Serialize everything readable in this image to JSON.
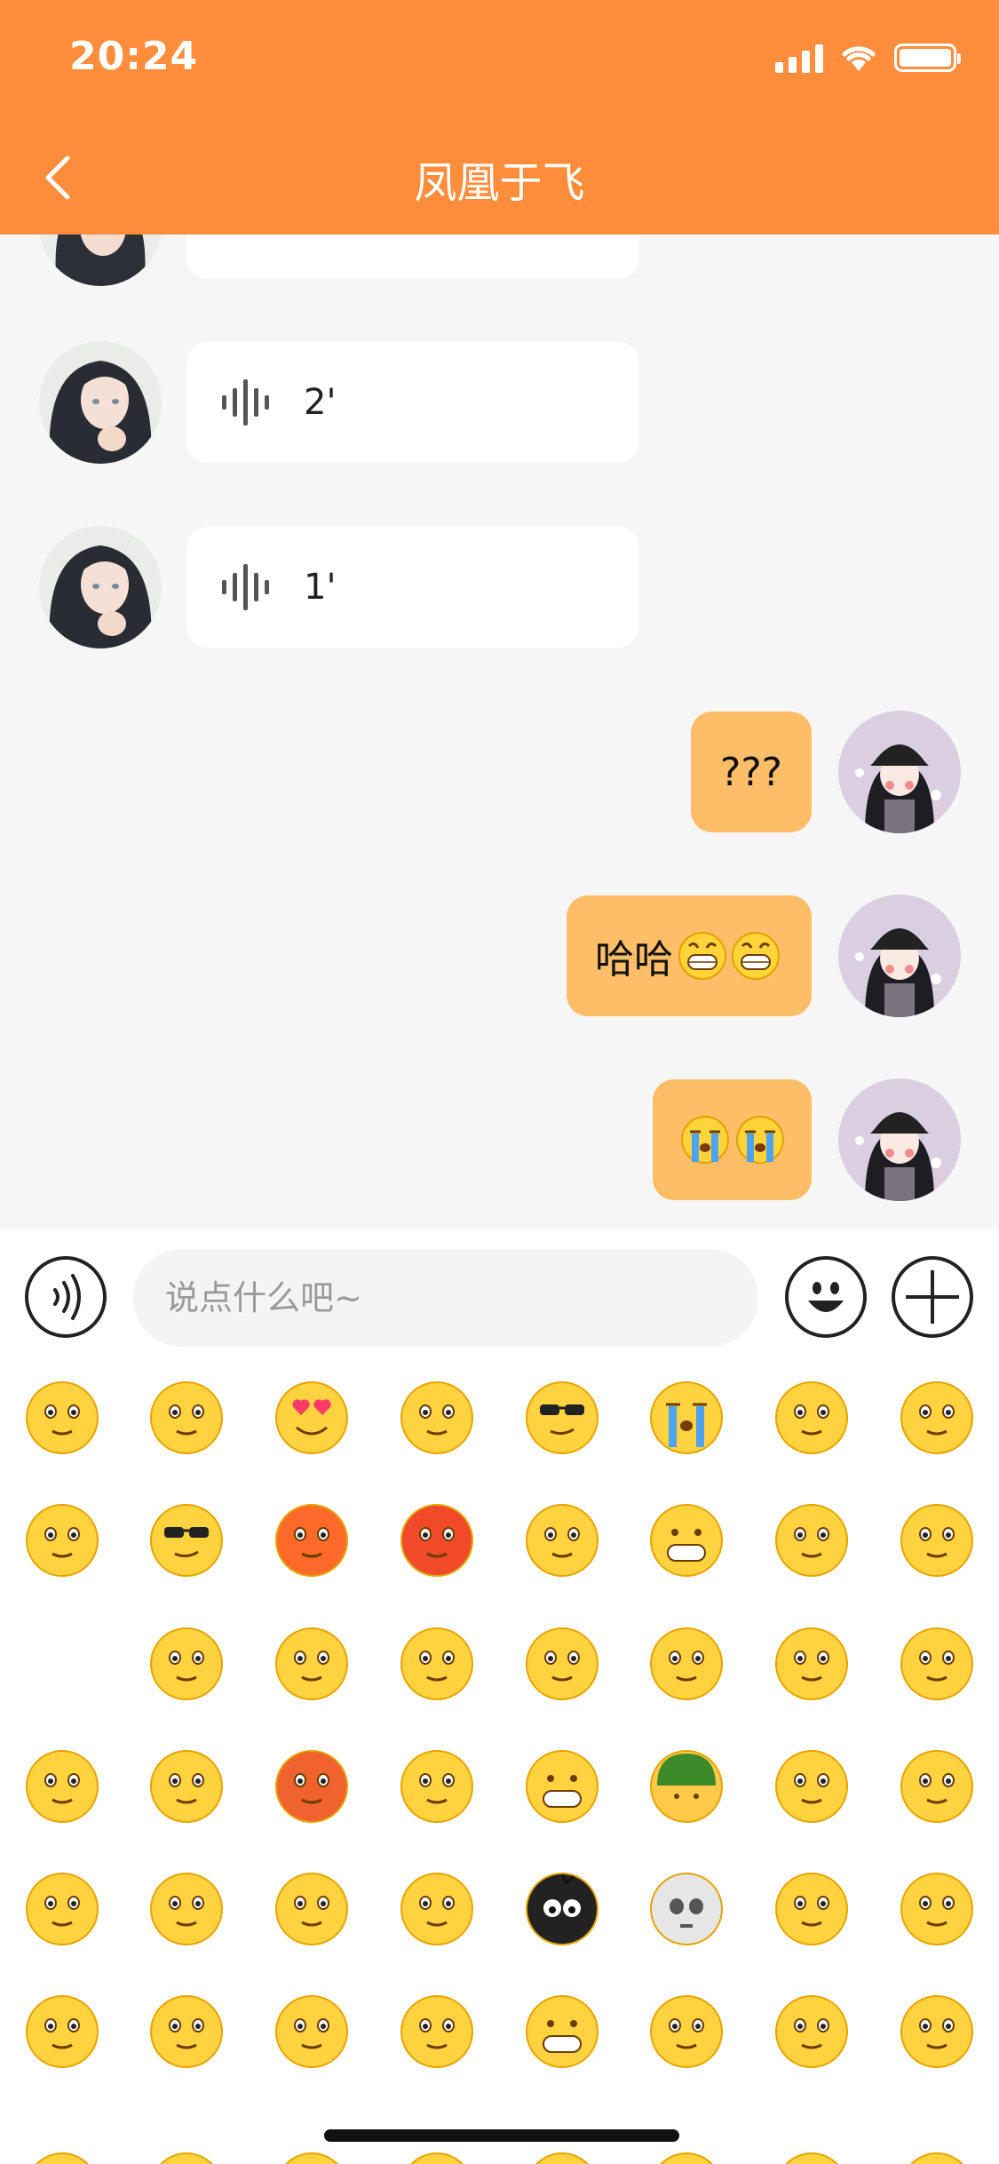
{
  "status_bar": {
    "time": "20:24"
  },
  "header": {
    "title": "凤凰于飞"
  },
  "messages": [
    {
      "side": "in",
      "type": "voice",
      "duration": "2'"
    },
    {
      "side": "in",
      "type": "voice",
      "duration": "1'"
    },
    {
      "side": "out",
      "type": "text",
      "text": "???"
    },
    {
      "side": "out",
      "type": "text",
      "text": "哈哈"
    },
    {
      "side": "out",
      "type": "emoji-only",
      "text": ""
    }
  ],
  "input_bar": {
    "placeholder": "说点什么吧~"
  },
  "colors": {
    "header": "#FF8D3C",
    "outgoing_bubble": "#FDBE67",
    "incoming_bubble": "#FFFFFF"
  },
  "emoji_panel": {
    "icons": [
      "smile-icon",
      "worried-icon",
      "heart-eyes-icon",
      "glare-icon",
      "sunglasses-icon",
      "crying-icon",
      "shy-icon",
      "no-speak-icon",
      "sleepy-icon",
      "cool-icon",
      "sweat-icon",
      "angry-icon",
      "tongue-icon",
      "grin-icon",
      "shocked-icon",
      "sad-icon",
      "",
      "flushed-icon",
      "scream-icon",
      "sick-icon",
      "cover-mouth-icon",
      "blush-icon",
      "surprised-icon",
      "thinking-icon",
      "smirk-icon",
      "eye-roll-icon",
      "anxious-icon",
      "side-eye-icon",
      "laugh-icon",
      "soldier-helmet-icon",
      "headband-icon",
      "rofl-icon",
      "question-icon",
      "shush-icon",
      "dizzy-icon",
      "squint-icon",
      "bomb-icon",
      "skull-icon",
      "frying-pan-icon",
      "facepalm-icon",
      "sweat-smile-icon",
      "pensive-icon",
      "pray-icon",
      "grimace-icon",
      "big-grin-icon",
      "peek-icon",
      "smug-icon",
      "pick-nose-icon"
    ]
  }
}
